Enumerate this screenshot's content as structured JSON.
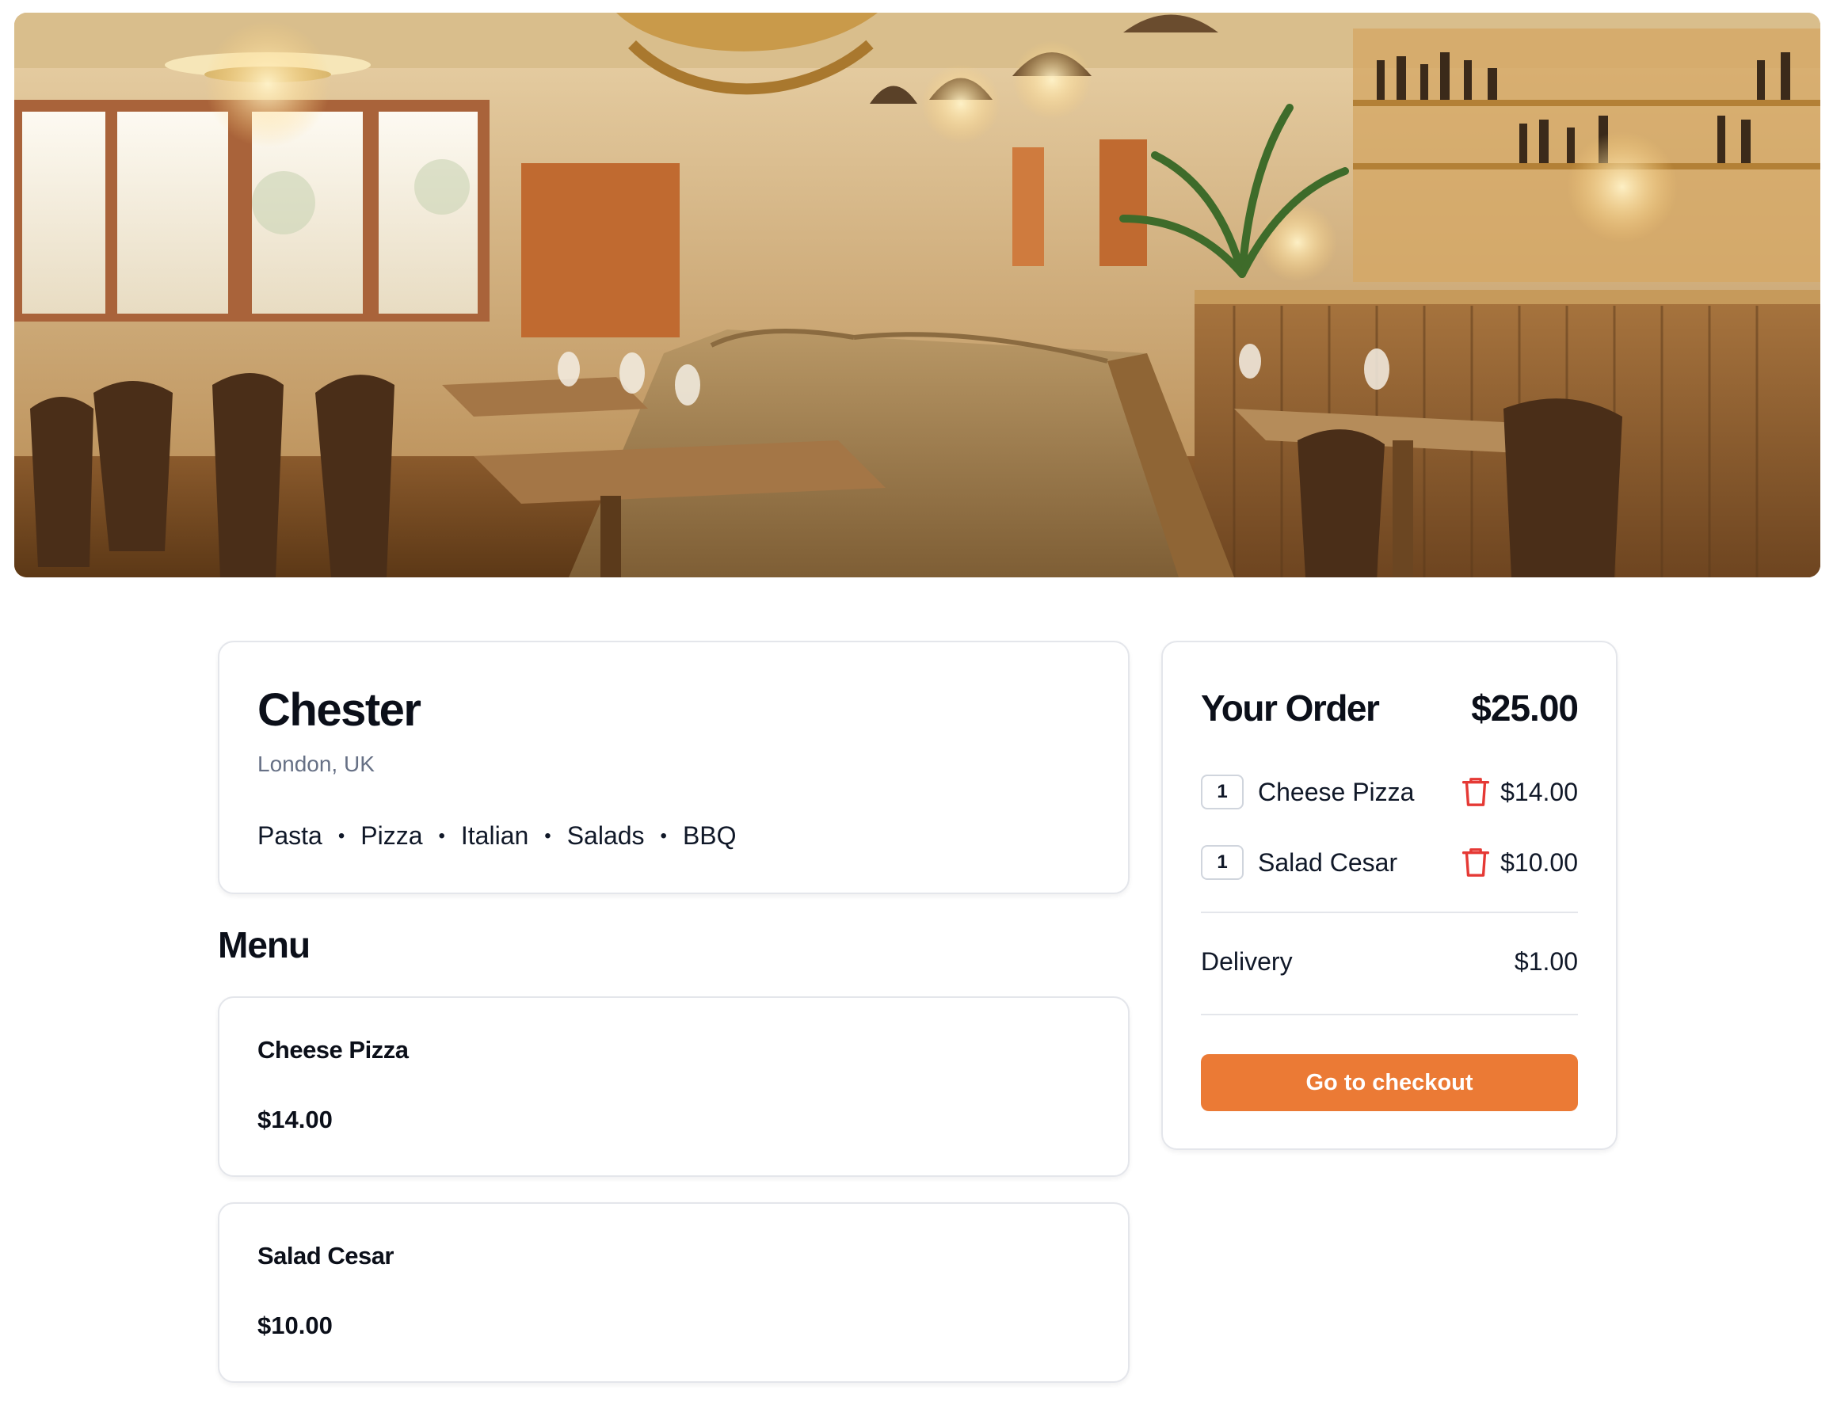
{
  "hero": {
    "image_alt": "restaurant-interior-photo"
  },
  "restaurant": {
    "name": "Chester",
    "location": "London, UK",
    "tags": [
      "Pasta",
      "Pizza",
      "Italian",
      "Salads",
      "BBQ"
    ],
    "tag_separator": "•"
  },
  "menu": {
    "heading": "Menu",
    "items": [
      {
        "name": "Cheese Pizza",
        "price": "$14.00"
      },
      {
        "name": "Salad Cesar",
        "price": "$10.00"
      }
    ]
  },
  "order": {
    "title": "Your Order",
    "total": "$25.00",
    "lines": [
      {
        "qty": "1",
        "name": "Cheese Pizza",
        "price": "$14.00",
        "icon": "trash-icon"
      },
      {
        "qty": "1",
        "name": "Salad Cesar",
        "price": "$10.00",
        "icon": "trash-icon"
      }
    ],
    "delivery_label": "Delivery",
    "delivery_price": "$1.00",
    "checkout_label": "Go to checkout"
  },
  "colors": {
    "accent": "#eb7a35",
    "trash": "#e53935",
    "muted_text": "#667085",
    "border": "#e4e6eb"
  }
}
